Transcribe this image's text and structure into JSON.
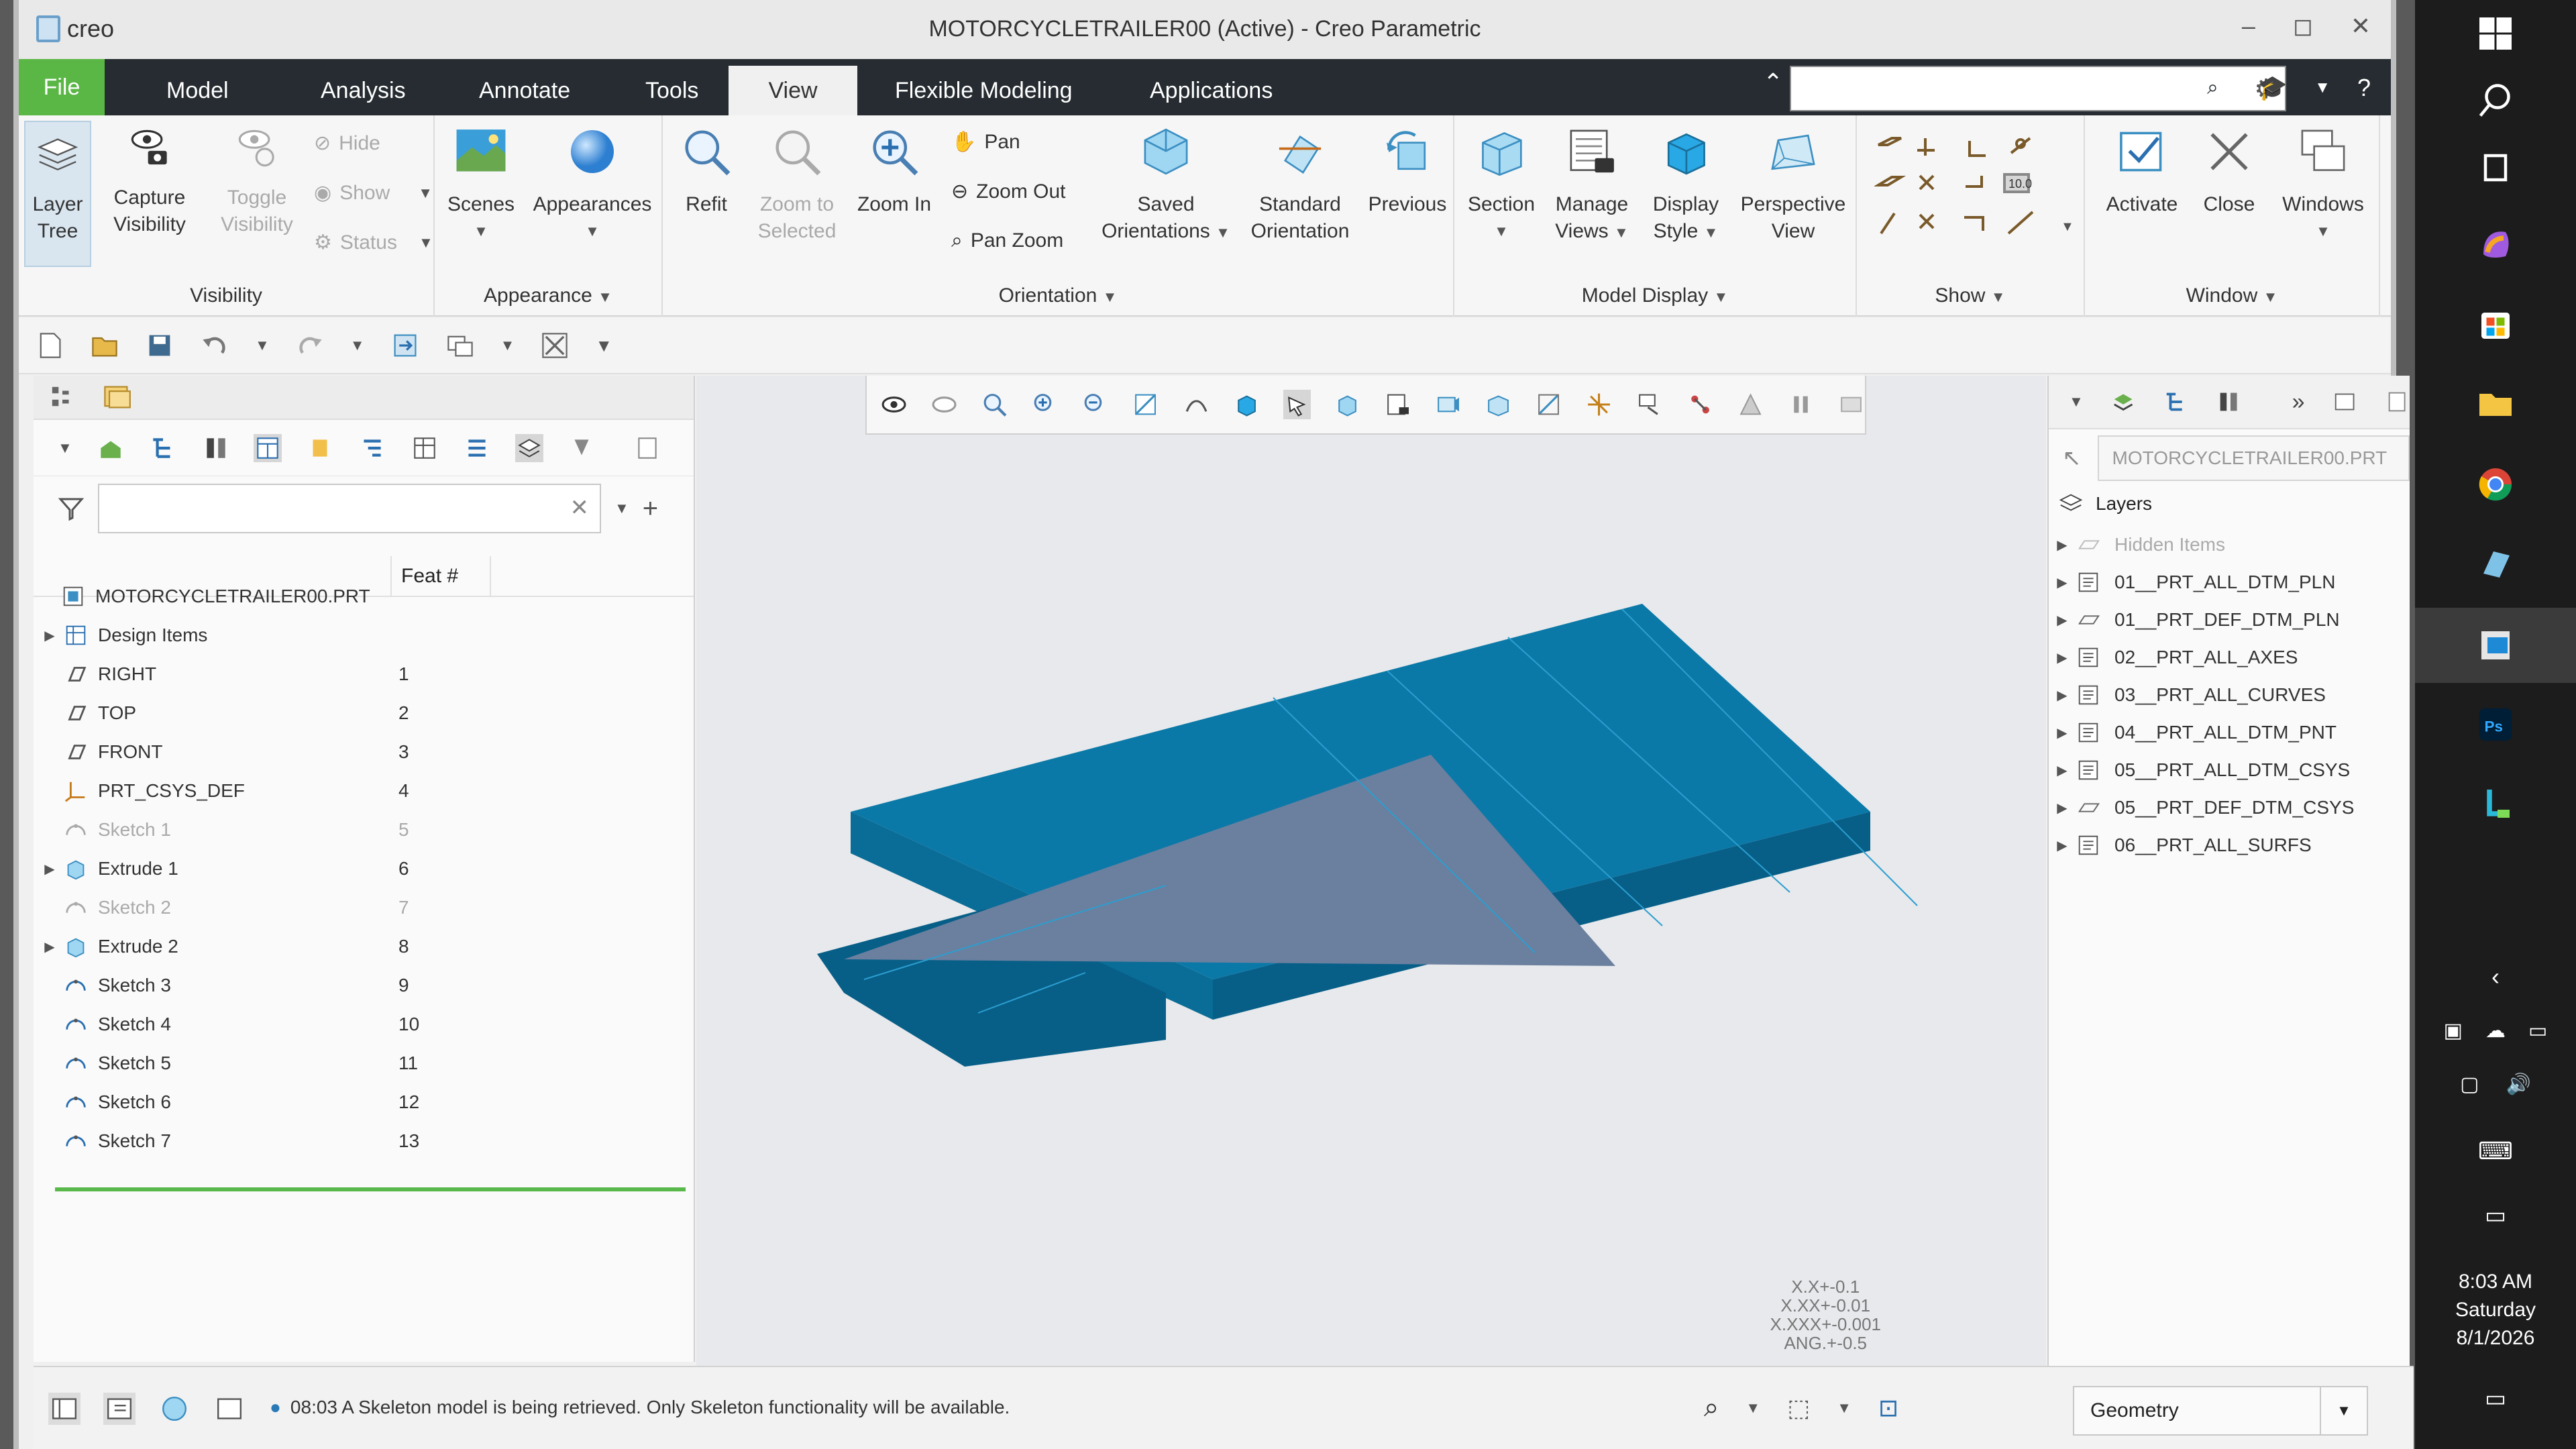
{
  "app": {
    "logo": "creo",
    "title": "MOTORCYCLETRAILER00 (Active) - Creo Parametric",
    "window_controls": [
      "–",
      "◻",
      "✕"
    ]
  },
  "tabs": [
    "File",
    "Model",
    "Analysis",
    "Annotate",
    "Tools",
    "View",
    "Flexible Modeling",
    "Applications"
  ],
  "ribbon": {
    "visibility": {
      "label": "Visibility",
      "layer_tree": [
        "Layer",
        "Tree"
      ],
      "capture_visibility": [
        "Capture",
        "Visibility"
      ],
      "toggle_visibility": [
        "Toggle",
        "Visibility"
      ],
      "hide": "Hide",
      "show": "Show",
      "status": "Status"
    },
    "appearance": {
      "label": "Appearance",
      "scenes": "Scenes",
      "appearances": "Appearances"
    },
    "orientation": {
      "label": "Orientation",
      "refit": "Refit",
      "zoom_to_selected": [
        "Zoom to",
        "Selected"
      ],
      "zoom_in": "Zoom In",
      "pan": "Pan",
      "zoom_out": "Zoom Out",
      "pan_zoom": "Pan Zoom",
      "saved_orientations": [
        "Saved",
        "Orientations"
      ],
      "standard_orientation": [
        "Standard",
        "Orientation"
      ],
      "previous": "Previous"
    },
    "model_display": {
      "label": "Model Display",
      "section": "Section",
      "manage_views": [
        "Manage",
        "Views"
      ],
      "display_style": [
        "Display",
        "Style"
      ],
      "perspective_view": [
        "Perspective",
        "View"
      ]
    },
    "show": {
      "label": "Show",
      "readout": "10.0"
    },
    "window": {
      "label": "Window",
      "activate": "Activate",
      "close": "Close",
      "windows": "Windows"
    }
  },
  "model_tree": {
    "feat_col": "Feat #",
    "root": "MOTORCYCLETRAILER00.PRT",
    "rows": [
      {
        "name": "Design Items",
        "feat": "",
        "icon": "design-items-icon",
        "dim": false,
        "expandable": true
      },
      {
        "name": "RIGHT",
        "feat": "1",
        "icon": "datum-plane-icon",
        "dim": false,
        "expandable": false
      },
      {
        "name": "TOP",
        "feat": "2",
        "icon": "datum-plane-icon",
        "dim": false,
        "expandable": false
      },
      {
        "name": "FRONT",
        "feat": "3",
        "icon": "datum-plane-icon",
        "dim": false,
        "expandable": false
      },
      {
        "name": "PRT_CSYS_DEF",
        "feat": "4",
        "icon": "csys-icon",
        "dim": false,
        "expandable": false
      },
      {
        "name": "Sketch 1",
        "feat": "5",
        "icon": "sketch-icon",
        "dim": true,
        "expandable": false
      },
      {
        "name": "Extrude 1",
        "feat": "6",
        "icon": "extrude-icon",
        "dim": false,
        "expandable": true
      },
      {
        "name": "Sketch 2",
        "feat": "7",
        "icon": "sketch-icon",
        "dim": true,
        "expandable": false
      },
      {
        "name": "Extrude 2",
        "feat": "8",
        "icon": "extrude-icon",
        "dim": false,
        "expandable": true
      },
      {
        "name": "Sketch 3",
        "feat": "9",
        "icon": "sketch-icon",
        "dim": false,
        "expandable": false
      },
      {
        "name": "Sketch 4",
        "feat": "10",
        "icon": "sketch-icon",
        "dim": false,
        "expandable": false
      },
      {
        "name": "Sketch 5",
        "feat": "11",
        "icon": "sketch-icon",
        "dim": false,
        "expandable": false
      },
      {
        "name": "Sketch 6",
        "feat": "12",
        "icon": "sketch-icon",
        "dim": false,
        "expandable": false
      },
      {
        "name": "Sketch 7",
        "feat": "13",
        "icon": "sketch-icon",
        "dim": false,
        "expandable": false
      }
    ]
  },
  "layers": {
    "model": "MOTORCYCLETRAILER00.PRT",
    "title": "Layers",
    "rows": [
      {
        "name": "Hidden Items",
        "dim": true
      },
      {
        "name": "01__PRT_ALL_DTM_PLN",
        "dim": false
      },
      {
        "name": "01__PRT_DEF_DTM_PLN",
        "dim": false
      },
      {
        "name": "02__PRT_ALL_AXES",
        "dim": false
      },
      {
        "name": "03__PRT_ALL_CURVES",
        "dim": false
      },
      {
        "name": "04__PRT_ALL_DTM_PNT",
        "dim": false
      },
      {
        "name": "05__PRT_ALL_DTM_CSYS",
        "dim": false
      },
      {
        "name": "05__PRT_DEF_DTM_CSYS",
        "dim": false
      },
      {
        "name": "06__PRT_ALL_SURFS",
        "dim": false
      }
    ]
  },
  "graphics": {
    "tolerances": [
      "X.X+-0.1",
      "X.XX+-0.01",
      "X.XXX+-0.001",
      "ANG.+-0.5"
    ],
    "model_color": "#0b79a8",
    "overlay_color": "#6b7f9f"
  },
  "status": {
    "message": "08:03 A Skeleton model is being retrieved. Only Skeleton functionality will be available.",
    "filter": "Geometry"
  },
  "taskbar": {
    "time": "8:03 AM",
    "day": "Saturday",
    "date": "8/1/2026"
  }
}
